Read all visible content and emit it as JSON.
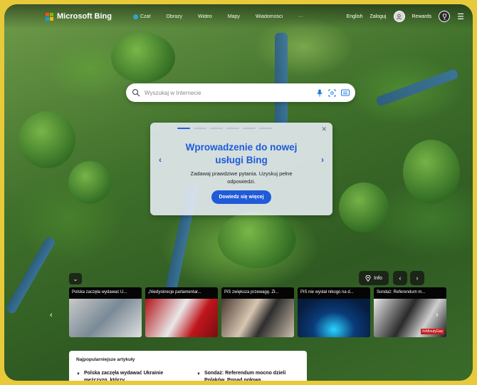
{
  "header": {
    "brand": "Microsoft Bing",
    "nav": [
      {
        "label": "Czat",
        "icon": "copilot-icon"
      },
      {
        "label": "Obrazy"
      },
      {
        "label": "Wideo"
      },
      {
        "label": "Mapy"
      },
      {
        "label": "Wiadomości"
      },
      {
        "label": "···"
      }
    ],
    "language": "English",
    "login": "Zaloguj",
    "rewards": "Rewards"
  },
  "search": {
    "placeholder": "Wyszukaj w Internecie"
  },
  "intro": {
    "title": "Wprowadzenie do nowej usługi Bing",
    "text": "Zadawaj prawdziwe pytania. Uzyskuj pełne odpowiedzi.",
    "button": "Dowiedz się więcej",
    "slides": 6,
    "active_slide": 1
  },
  "controls": {
    "info": "Info"
  },
  "news": [
    {
      "caption": "Polska zaczęła wydawać U...",
      "image_class": "img1"
    },
    {
      "caption": "„Niedyskrecje parlamentar...",
      "image_class": "img2"
    },
    {
      "caption": "PiS zwiększa przewagę. Zł...",
      "image_class": "img3"
    },
    {
      "caption": "PiS nie wysłał nikogo na d...",
      "image_class": "img4"
    },
    {
      "caption": "Sondaż: Referendum m...",
      "image_class": "img5",
      "badge": "#zMinutyGaz"
    }
  ],
  "articles": {
    "title": "Najpopularniejsze artykuły",
    "items": [
      {
        "text": "Polska zaczęła wydawać Ukrainie mężczyzn, którzy..."
      },
      {
        "text": "Sondaż: Referendum mocno dzieli Polaków. Ponad połowa..."
      }
    ]
  },
  "colors": {
    "accent": "#1f5bd9",
    "border": "#e8c93a"
  }
}
